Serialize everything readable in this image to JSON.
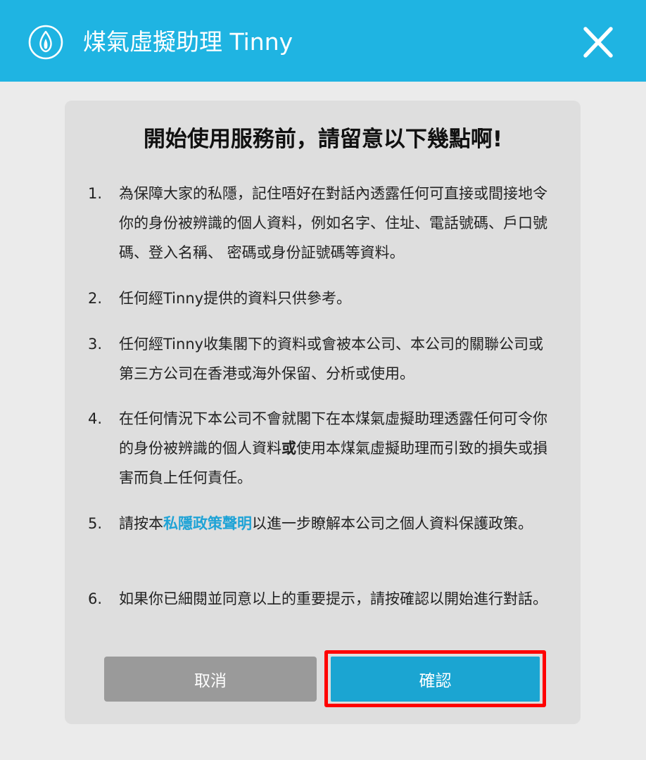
{
  "header": {
    "title": "煤氣虛擬助理 Tinny",
    "logo_icon": "flame-icon",
    "close_icon": "close-icon",
    "background_color": "#1fb4e2"
  },
  "dialog": {
    "heading": "開始使用服務前，請留意以下幾點啊!",
    "items": [
      {
        "number": "1.",
        "text": "為保障大家的私隱，記住唔好在對話內透露任何可直接或間接地令你的身份被辨識的個人資料，例如名字、住址、電話號碼、戶口號碼、登入名稱、 密碼或身份証號碼等資料。"
      },
      {
        "number": "2.",
        "text": "任何經Tinny提供的資料只供參考。"
      },
      {
        "number": "3.",
        "text": "任何經Tinny收集閣下的資料或會被本公司、本公司的關聯公司或第三方公司在香港或海外保留、分析或使用。"
      },
      {
        "number": "4.",
        "text_before": "在任何情況下本公司不會就閣下在本煤氣虛擬助理透露任何可令你的身份被辨識的個人資料",
        "text_bold": "或",
        "text_after": "使用本煤氣虛擬助理而引致的損失或損害而負上任何責任。"
      },
      {
        "number": "5.",
        "text_before": "請按本",
        "link": "私隱政策聲明",
        "text_after": "以進一步瞭解本公司之個人資料保護政策。"
      },
      {
        "number": "6.",
        "text": "如果你已細閱並同意以上的重要提示，請按確認以開始進行對話。"
      }
    ],
    "cancel_label": "取消",
    "confirm_label": "確認",
    "link_color": "#1fa3d6",
    "highlight_color": "#ff0000"
  }
}
